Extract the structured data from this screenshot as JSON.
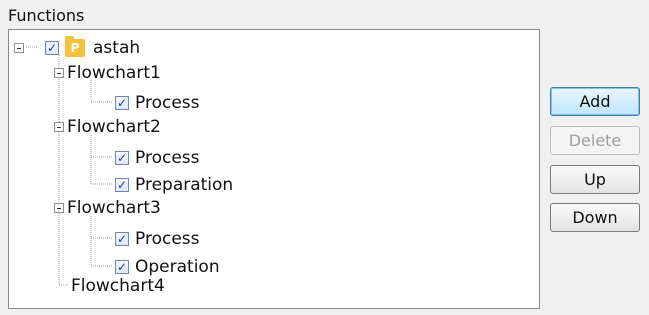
{
  "group_label": "Functions",
  "tree": {
    "root": {
      "label": "astah",
      "checked": true,
      "expanded": true,
      "icon": "project-icon",
      "icon_letter": "P"
    },
    "flowcharts": [
      {
        "label": "Flowchart1",
        "expanded": true,
        "children": [
          {
            "label": "Process",
            "checked": true
          }
        ]
      },
      {
        "label": "Flowchart2",
        "expanded": true,
        "children": [
          {
            "label": "Process",
            "checked": true
          },
          {
            "label": "Preparation",
            "checked": true
          }
        ]
      },
      {
        "label": "Flowchart3",
        "expanded": true,
        "children": [
          {
            "label": "Process",
            "checked": true
          },
          {
            "label": "Operation",
            "checked": true
          }
        ]
      },
      {
        "label": "Flowchart4",
        "expanded": false,
        "children": []
      }
    ]
  },
  "buttons": {
    "add": "Add",
    "delete": "Delete",
    "up": "Up",
    "down": "Down"
  },
  "colors": {
    "tree_background": "#ffffff",
    "dialog_background": "#f0f0f0",
    "add_button_highlight": "#bee6fd",
    "disabled_text": "#a0a0a0"
  }
}
